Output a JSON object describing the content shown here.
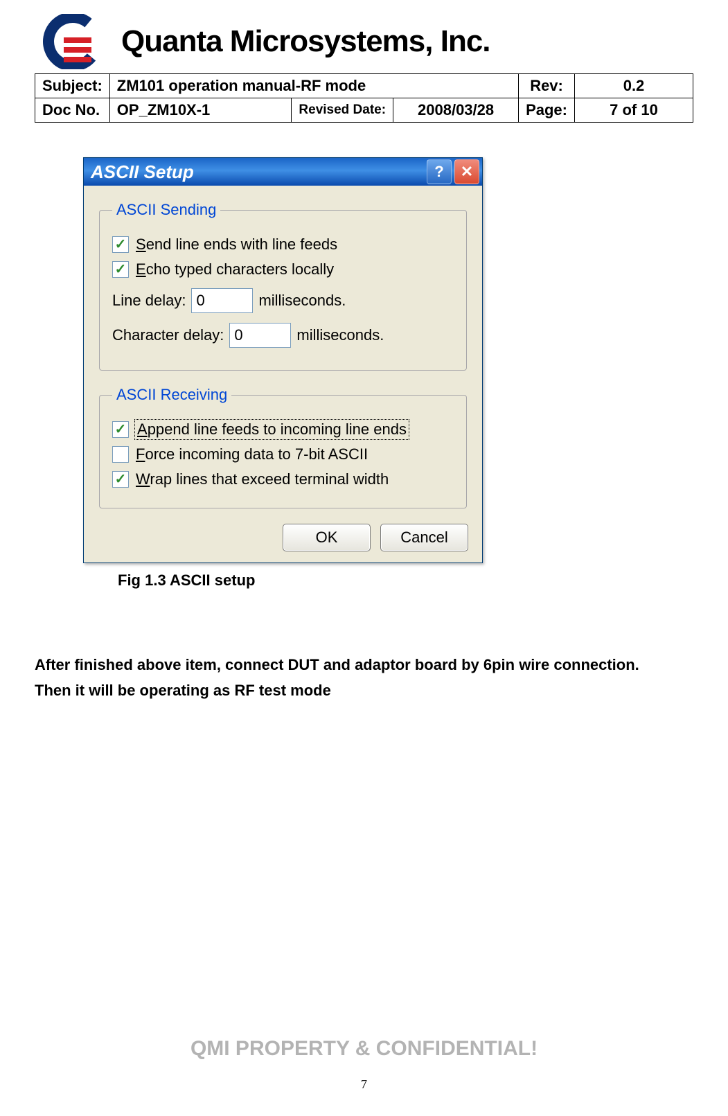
{
  "company": "Quanta Microsystems, Inc.",
  "meta": {
    "subject_label": "Subject:",
    "subject": "ZM101 operation manual-RF mode",
    "rev_label": "Rev:",
    "rev": "0.2",
    "docno_label": "Doc No.",
    "docno": "OP_ZM10X-1",
    "revised_label": "Revised Date:",
    "revised": "2008/03/28",
    "page_label": "Page:",
    "page": "7 of 10"
  },
  "dialog": {
    "title": "ASCII Setup",
    "help_symbol": "?",
    "close_symbol": "✕",
    "groups": {
      "sending": {
        "legend": "ASCII Sending",
        "chk_send": {
          "checked": true,
          "pre": "",
          "u": "S",
          "rest": "end line ends with line feeds"
        },
        "chk_echo": {
          "checked": true,
          "pre": "",
          "u": "E",
          "rest": "cho typed characters locally"
        },
        "line_delay": {
          "pre": "",
          "u": "L",
          "mid": "ine delay:",
          "value": "0",
          "suffix": "milliseconds."
        },
        "char_delay": {
          "pre": "",
          "u": "C",
          "mid": "haracter delay:",
          "value": "0",
          "suffix": "milliseconds."
        }
      },
      "receiving": {
        "legend": "ASCII Receiving",
        "chk_append": {
          "checked": true,
          "pre": "",
          "u": "A",
          "rest": "ppend line feeds to incoming line ends"
        },
        "chk_force": {
          "checked": false,
          "pre": "",
          "u": "F",
          "rest": "orce incoming data to 7-bit ASCII"
        },
        "chk_wrap": {
          "checked": true,
          "pre": "",
          "u": "W",
          "rest": "rap lines that exceed terminal width"
        }
      }
    },
    "buttons": {
      "ok": "OK",
      "cancel": "Cancel"
    }
  },
  "caption": "Fig 1.3 ASCII setup",
  "body_text_1": "After finished above item, connect DUT and adaptor board by 6pin wire connection.",
  "body_text_2": "Then it will be operating as RF test mode",
  "watermark": "QMI PROPERTY & CONFIDENTIAL!",
  "page_number": "7"
}
